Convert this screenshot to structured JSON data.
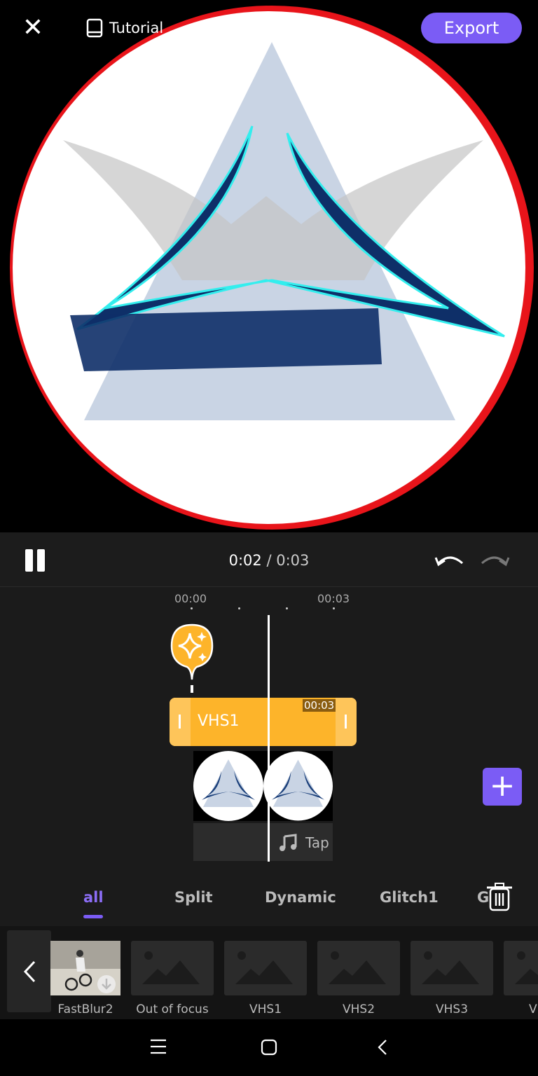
{
  "header": {
    "close_icon": "close-icon",
    "tutorial_label": "Tutorial",
    "export_label": "Export"
  },
  "playback": {
    "current": "0:02",
    "separator": "/",
    "total": "0:03"
  },
  "timeline": {
    "ruler": [
      "00:00",
      "00:03"
    ],
    "effect_clip": {
      "label": "VHS1",
      "duration": "00:03"
    },
    "audio_label": "Tap"
  },
  "tabs": [
    {
      "label": "all",
      "active": true
    },
    {
      "label": "Split"
    },
    {
      "label": "Dynamic"
    },
    {
      "label": "Glitch1"
    },
    {
      "label": "G"
    }
  ],
  "effects": [
    "FastBlur2",
    "Out of focus",
    "VHS1",
    "VHS2",
    "VHS3",
    "V"
  ],
  "colors": {
    "accent": "#7b5cf5",
    "effect_clip": "#fdb42a"
  }
}
